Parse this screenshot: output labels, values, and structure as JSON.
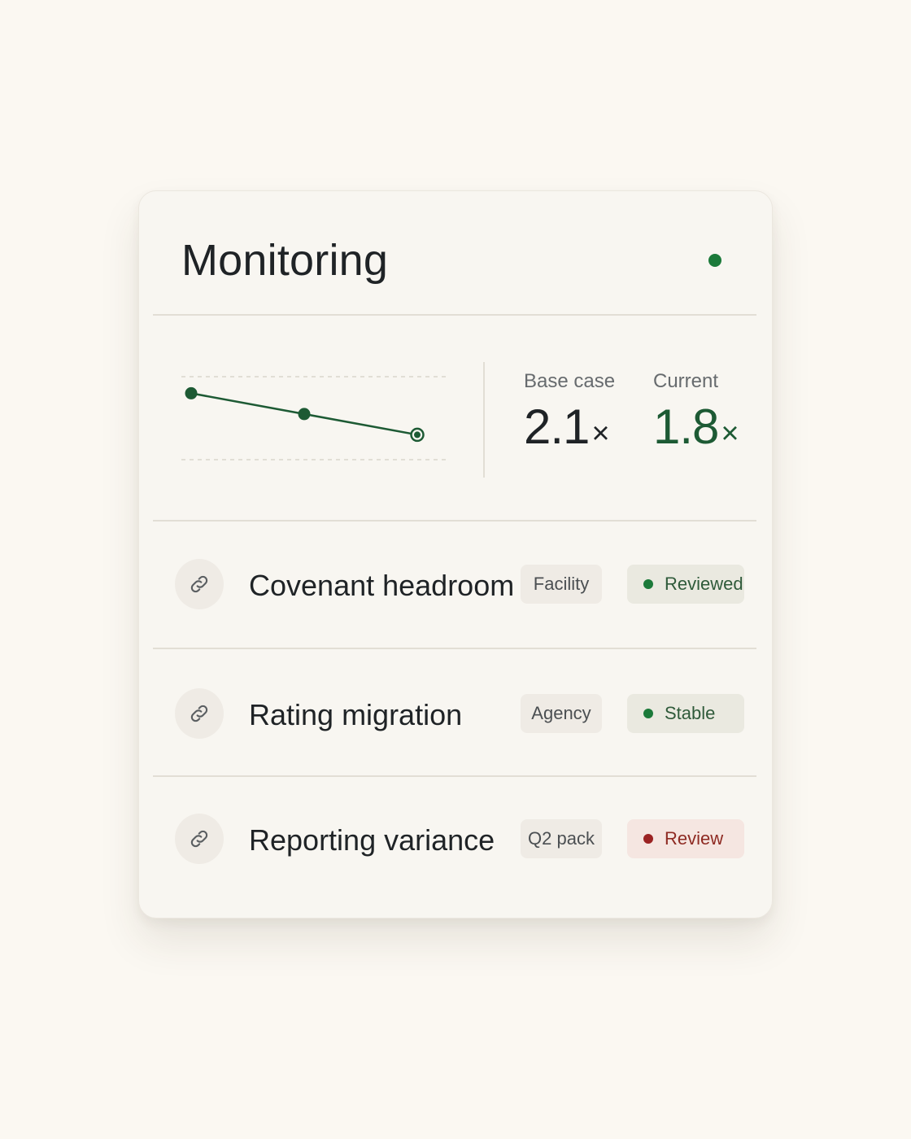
{
  "header": {
    "title": "Monitoring",
    "status_color": "#1c7a3a"
  },
  "chart_data": {
    "type": "line",
    "title": "",
    "xlabel": "",
    "ylabel": "",
    "series": [
      {
        "values": [
          2.1,
          1.95,
          1.8
        ]
      }
    ],
    "grid": "two dashed reference lines",
    "line_color": "#1d5a34",
    "last_point_style": "hollow ring"
  },
  "metrics": {
    "base": {
      "label": "Base case",
      "value": "2.1",
      "unit": "×"
    },
    "current": {
      "label": "Current",
      "value": "1.8",
      "unit": "×"
    }
  },
  "rows": [
    {
      "icon": "link-icon",
      "label": "Covenant headroom",
      "tag": "Facility",
      "status": "Reviewed",
      "status_tone": "ok"
    },
    {
      "icon": "link-icon",
      "label": "Rating migration",
      "tag": "Agency",
      "status": "Stable",
      "status_tone": "ok"
    },
    {
      "icon": "link-icon",
      "label": "Reporting variance",
      "tag": "Q2 pack",
      "status": "Review",
      "status_tone": "warn"
    }
  ],
  "colors": {
    "ok": "#1c7a3a",
    "warn": "#9b2323",
    "accent_value": "#1d5a34"
  }
}
